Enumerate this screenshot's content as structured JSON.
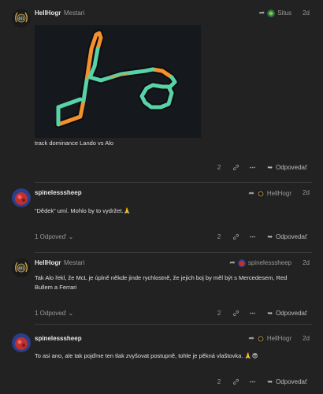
{
  "posts": [
    {
      "username": "HellHogr",
      "user_title": "Mestari",
      "reply_to": "Situs",
      "date": "2d",
      "caption": "track dominance Lando vs Alo",
      "likes": "2",
      "reply_label": "Odpovedať"
    },
    {
      "username": "spinelesssheep",
      "reply_to": "HellHogr",
      "date": "2d",
      "text": "“Dědek” umí. Mohlo by to vydržet.🙏",
      "replies_label": "1 Odpoveď",
      "likes": "2",
      "reply_label": "Odpovedať"
    },
    {
      "username": "HellHogr",
      "user_title": "Mestari",
      "reply_to": "spinelesssheep",
      "date": "2d",
      "text": "Tak Alo řekl, že McL je úplně někde jinde rychlostně, že jejich boj by měl být s Mercedesem, Red Bullem a Ferrari",
      "replies_label": "1 Odpoveď",
      "likes": "2",
      "reply_label": "Odpovedať"
    },
    {
      "username": "spinelesssheep",
      "reply_to": "HellHogr",
      "date": "2d",
      "text": "To asi ano, ale tak pojďme ten tlak zvyšovat postupně, tohle je pěkná vlaštovka. 🙏😎",
      "likes": "2",
      "reply_label": "Odpovedať"
    }
  ],
  "colors": {
    "background": "#222222",
    "track_orange": "#f5902e",
    "track_green": "#58d3a8",
    "text": "#e0e0e0",
    "muted": "#9a9a9a"
  },
  "icons": [
    "reply-arrow-icon",
    "heart-icon",
    "link-icon",
    "more-icon",
    "reply-icon",
    "chevron-down-icon"
  ]
}
